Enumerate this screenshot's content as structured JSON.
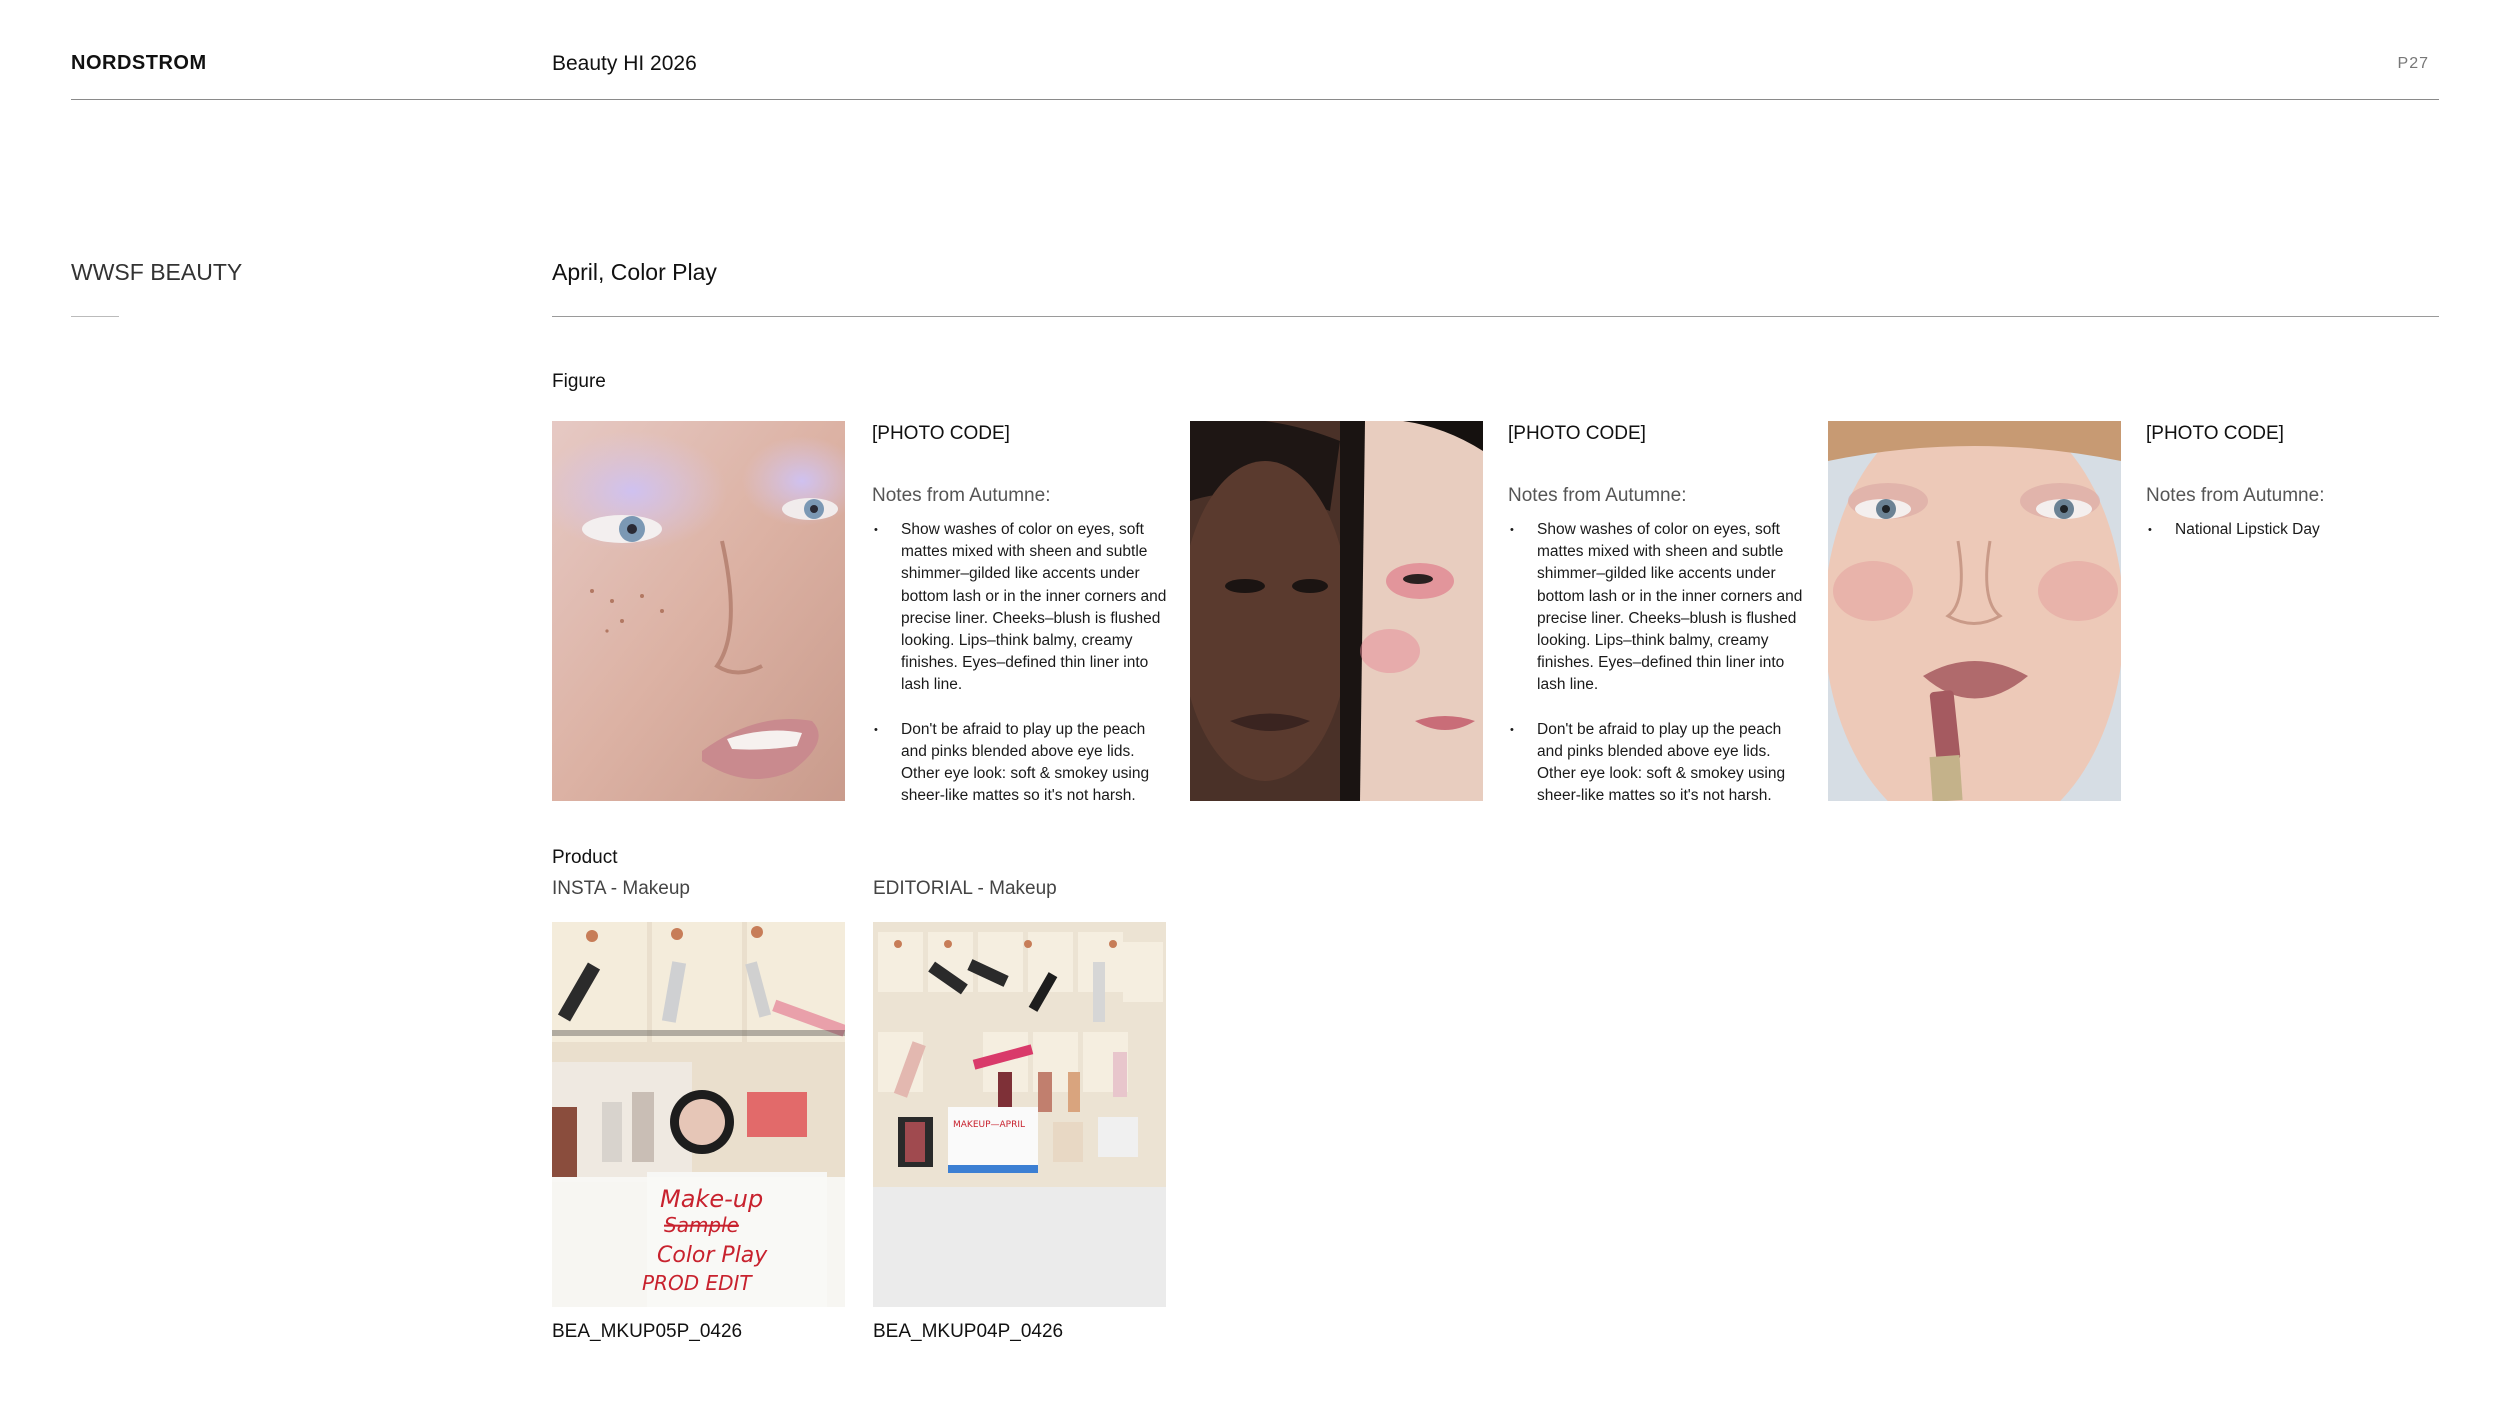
{
  "header": {
    "brand": "NORDSTROM",
    "title": "Beauty HI 2026",
    "page": "P27"
  },
  "section": {
    "name": "WWSF BEAUTY",
    "month": "April, Color Play",
    "figure_label": "Figure"
  },
  "figures": [
    {
      "photo_code": "[PHOTO CODE]",
      "notes_title": "Notes from Autumne:",
      "bullets": [
        "Show washes of color on eyes, soft mattes mixed with sheen and subtle shimmer–gilded like accents under bottom lash or in the inner corners and precise liner. Cheeks–blush is flushed looking. Lips–think balmy, creamy finishes. Eyes–defined thin liner into lash line.",
        "Don't be afraid to play up the peach and pinks blended above eye lids. Other eye look: soft & smokey using sheer-like mattes so it's not harsh."
      ]
    },
    {
      "photo_code": "[PHOTO CODE]",
      "notes_title": "Notes from Autumne:",
      "bullets": [
        "Show washes of color on eyes, soft mattes mixed with sheen and subtle shimmer–gilded like accents under bottom lash or in the inner corners and precise liner. Cheeks–blush is flushed looking. Lips–think balmy, creamy finishes. Eyes–defined thin liner into lash line.",
        "Don't be afraid to play up the peach and pinks blended above eye lids. Other eye look: soft & smokey using sheer-like mattes so it's not harsh."
      ]
    },
    {
      "photo_code": "[PHOTO CODE]",
      "notes_title": "Notes from Autumne:",
      "bullets": [
        "National Lipstick Day"
      ]
    }
  ],
  "product": {
    "label": "Product",
    "items": [
      {
        "category": "INSTA - Makeup",
        "code": "BEA_MKUP05P_0426",
        "handwriting": [
          "Make-up",
          "Sample",
          "Color Play",
          "PROD EDIT"
        ]
      },
      {
        "category": "EDITORIAL - Makeup",
        "code": "BEA_MKUP04P_0426"
      }
    ]
  },
  "colors": {
    "rule": "#8a8a8a",
    "text": "#111111",
    "muted": "#555555"
  }
}
